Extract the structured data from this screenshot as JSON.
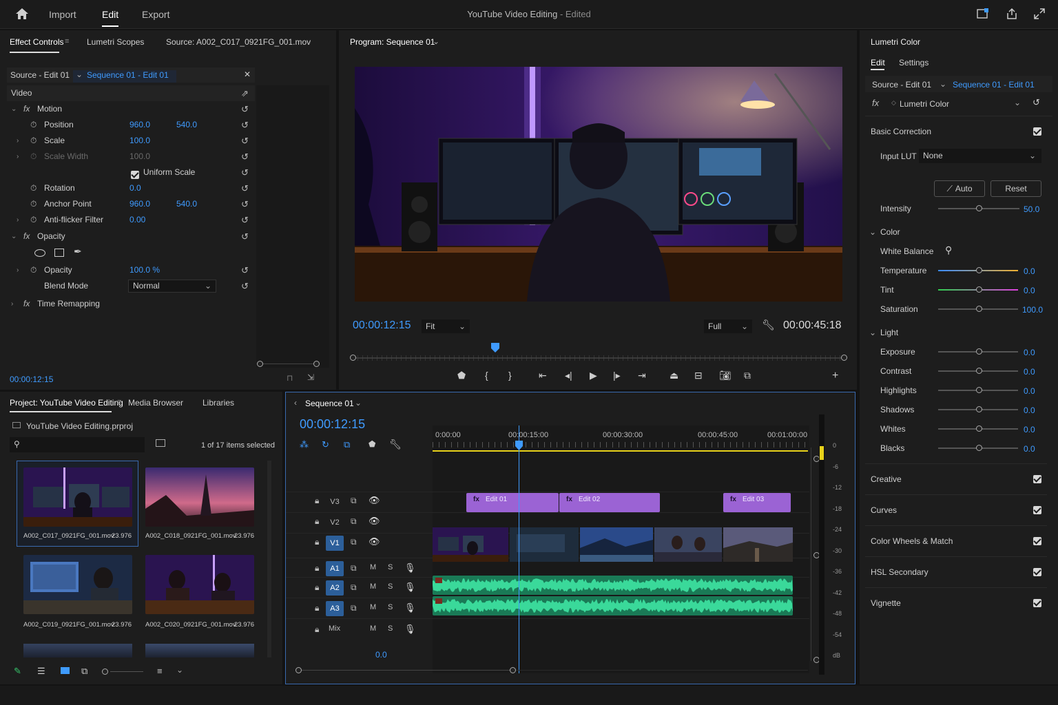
{
  "topbar": {
    "nav": [
      "Import",
      "Edit",
      "Export"
    ],
    "active": "Edit",
    "title": "YouTube Video Editing",
    "title_state": "- Edited"
  },
  "effect_controls": {
    "tabs": [
      "Effect Controls",
      "Lumetri Scopes",
      "Source: A002_C017_0921FG_001.mov"
    ],
    "source_label": "Source - Edit 01",
    "sequence_label": "Sequence 01 - Edit 01",
    "video_label": "Video",
    "motion": "Motion",
    "position": {
      "label": "Position",
      "x": "960.0",
      "y": "540.0"
    },
    "scale": {
      "label": "Scale",
      "value": "100.0"
    },
    "scale_width": {
      "label": "Scale Width",
      "value": "100.0"
    },
    "uniform_scale": "Uniform Scale",
    "rotation": {
      "label": "Rotation",
      "value": "0.0"
    },
    "anchor": {
      "label": "Anchor Point",
      "x": "960.0",
      "y": "540.0"
    },
    "antiflicker": {
      "label": "Anti-flicker Filter",
      "value": "0.00"
    },
    "opacity_group": "Opacity",
    "opacity": {
      "label": "Opacity",
      "value": "100.0 %"
    },
    "blend": {
      "label": "Blend Mode",
      "value": "Normal"
    },
    "time_remap": "Time Remapping",
    "timecode": "00:00:12:15"
  },
  "program": {
    "title": "Program: Sequence 01",
    "timecode": "00:00:12:15",
    "fit": "Fit",
    "quality": "Full",
    "duration": "00:00:45:18",
    "playhead_fraction": 0.29
  },
  "lumetri": {
    "title": "Lumetri Color",
    "tabs": [
      "Edit",
      "Settings"
    ],
    "source_label": "Source - Edit 01",
    "sequence_label": "Sequence 01 - Edit 01",
    "effect": "Lumetri Color",
    "basic": "Basic Correction",
    "input_lut": {
      "label": "Input LUT",
      "value": "None"
    },
    "auto": "Auto",
    "reset": "Reset",
    "intensity": {
      "label": "Intensity",
      "value": "50.0"
    },
    "color": "Color",
    "white_balance": "White Balance",
    "temperature": {
      "label": "Temperature",
      "value": "0.0"
    },
    "tint": {
      "label": "Tint",
      "value": "0.0"
    },
    "saturation": {
      "label": "Saturation",
      "value": "100.0"
    },
    "light": "Light",
    "light_rows": [
      {
        "label": "Exposure",
        "value": "0.0"
      },
      {
        "label": "Contrast",
        "value": "0.0"
      },
      {
        "label": "Highlights",
        "value": "0.0"
      },
      {
        "label": "Shadows",
        "value": "0.0"
      },
      {
        "label": "Whites",
        "value": "0.0"
      },
      {
        "label": "Blacks",
        "value": "0.0"
      }
    ],
    "sections": [
      "Creative",
      "Curves",
      "Color Wheels & Match",
      "HSL Secondary",
      "Vignette"
    ]
  },
  "project": {
    "tabs": [
      "Project: YouTube Video Editing",
      "Media Browser",
      "Libraries"
    ],
    "file": "YouTube Video Editing.prproj",
    "selection": "1 of 17 items selected",
    "items": [
      {
        "name": "A002_C017_0921FG_001.mov",
        "fps": "23.976"
      },
      {
        "name": "A002_C018_0921FG_001.mov",
        "fps": "23.976"
      },
      {
        "name": "A002_C019_0921FG_001.mov",
        "fps": "23.976"
      },
      {
        "name": "A002_C020_0921FG_001.mov",
        "fps": "23.976"
      }
    ]
  },
  "timeline": {
    "title": "Sequence 01",
    "timecode": "00:00:12:15",
    "ruler": [
      "0:00:00",
      "00:00:15:00",
      "00:00:30:00",
      "00:00:45:00",
      "00:01:00:00"
    ],
    "tracks": {
      "video": [
        "V3",
        "V2",
        "V1"
      ],
      "audio": [
        "A1",
        "A2",
        "A3"
      ],
      "mix": "Mix",
      "m": "M",
      "s": "S",
      "mix_value": "0.0"
    },
    "clips_v3": [
      "Edit 01",
      "Edit 02",
      "Edit 03"
    ],
    "meter": [
      "0",
      "-6",
      "-12",
      "-18",
      "-24",
      "-30",
      "-36",
      "-42",
      "-48",
      "-54",
      "dB"
    ]
  },
  "colors": {
    "accent": "#3f9bff",
    "clip_purple": "#9b63d4",
    "audio_green": "#2fae7c",
    "playhead_yellow": "#e8d21a"
  }
}
